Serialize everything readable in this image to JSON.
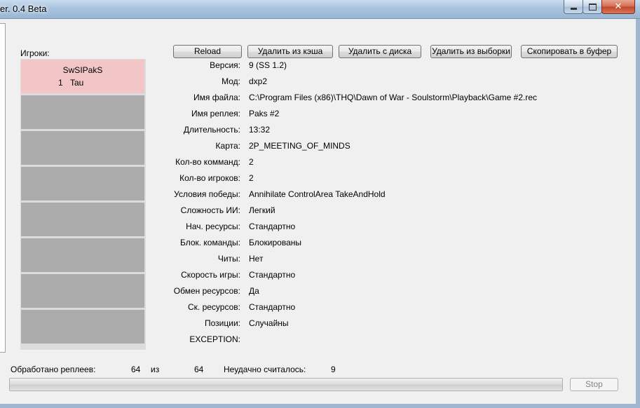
{
  "window": {
    "title": "er. 0.4 Beta",
    "background_tabs": [
      "",
      "",
      ""
    ]
  },
  "players": {
    "label": "Игроки:",
    "slots": [
      {
        "name": "SwSIPakS",
        "team": "1",
        "race": "Tau"
      }
    ]
  },
  "toolbar": {
    "reload": "Reload",
    "delete_cache": "Удалить из кэша",
    "delete_disk": "Удалить с диска",
    "delete_selection": "Удалить из выборки",
    "copy_buffer": "Скопировать в буфер"
  },
  "info": [
    {
      "label": "Версия:",
      "value": "9 (SS 1.2)"
    },
    {
      "label": "Мод:",
      "value": "dxp2"
    },
    {
      "label": "Имя файла:",
      "value": "C:\\Program Files (x86)\\THQ\\Dawn of War - Soulstorm\\Playback\\Game #2.rec"
    },
    {
      "label": "Имя реплея:",
      "value": "Paks #2"
    },
    {
      "label": "Длительность:",
      "value": "13:32"
    },
    {
      "label": "Карта:",
      "value": "2P_MEETING_OF_MINDS"
    },
    {
      "label": "Кол-во комманд:",
      "value": "2"
    },
    {
      "label": "Кол-во игроков:",
      "value": "2"
    },
    {
      "label": "Условия победы:",
      "value": "Annihilate ControlArea TakeAndHold"
    },
    {
      "label": "Сложность ИИ:",
      "value": "Легкий"
    },
    {
      "label": "Нач. ресурсы:",
      "value": "Стандартно"
    },
    {
      "label": "Блок. команды:",
      "value": "Блокированы"
    },
    {
      "label": "Читы:",
      "value": "Нет"
    },
    {
      "label": "Скорость игры:",
      "value": "Стандартно"
    },
    {
      "label": "Обмен ресурсов:",
      "value": "Да"
    },
    {
      "label": "Ск. ресурсов:",
      "value": "Стандартно"
    },
    {
      "label": "Позиции:",
      "value": "Случайны"
    },
    {
      "label": "EXCEPTION:",
      "value": ""
    }
  ],
  "status": {
    "processed_label": "Обработано реплеев:",
    "processed_count": "64",
    "of_label": "из",
    "total_count": "64",
    "failed_label": "Неудачно считалось:",
    "failed_count": "9",
    "progress": 0,
    "stop_label": "Stop"
  }
}
